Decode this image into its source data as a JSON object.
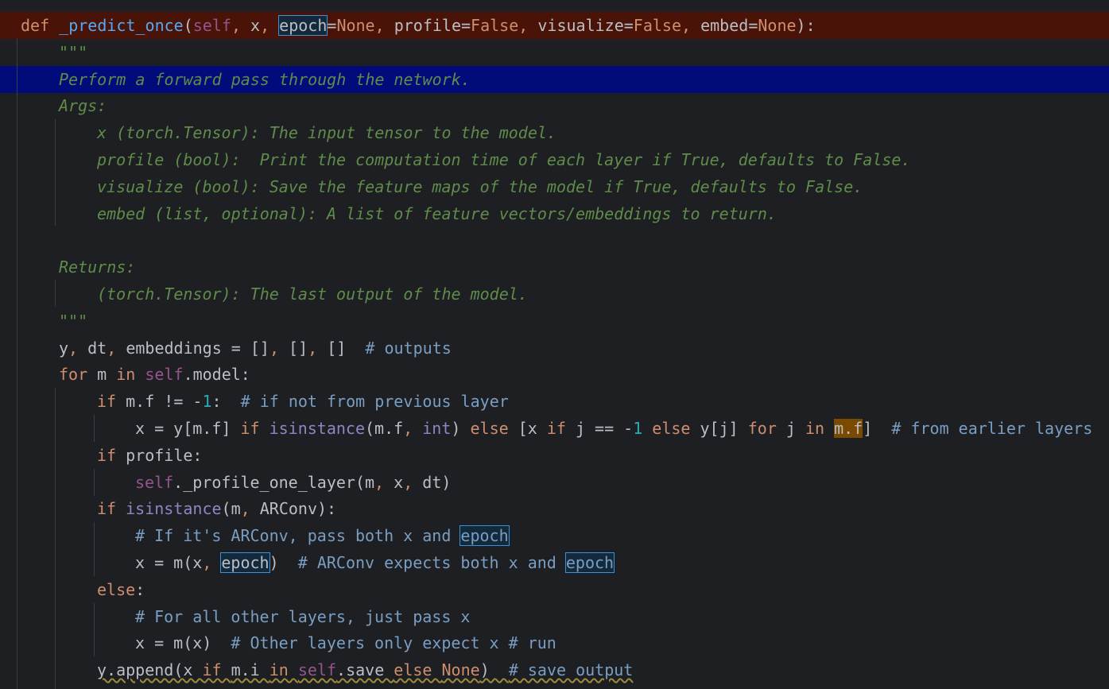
{
  "editor": {
    "lines": [
      {
        "indent": 0,
        "parts": [
          {
            "t": "def ",
            "c": "kw"
          },
          {
            "t": "_predict_once",
            "c": "fn"
          },
          {
            "t": "(",
            "c": "op"
          },
          {
            "t": "self",
            "c": "self"
          },
          {
            "t": ", ",
            "c": "kw"
          },
          {
            "t": "x",
            "c": "op"
          },
          {
            "t": ", ",
            "c": "kw"
          },
          {
            "t": "epoch",
            "c": "op",
            "box": true
          },
          {
            "t": "=",
            "c": "op"
          },
          {
            "t": "None",
            "c": "kw"
          },
          {
            "t": ", ",
            "c": "kw"
          },
          {
            "t": "profile",
            "c": "op"
          },
          {
            "t": "=",
            "c": "op"
          },
          {
            "t": "False",
            "c": "kw"
          },
          {
            "t": ", ",
            "c": "kw"
          },
          {
            "t": "visualize",
            "c": "op"
          },
          {
            "t": "=",
            "c": "op"
          },
          {
            "t": "False",
            "c": "kw"
          },
          {
            "t": ", ",
            "c": "kw"
          },
          {
            "t": "embed",
            "c": "op"
          },
          {
            "t": "=",
            "c": "op"
          },
          {
            "t": "None",
            "c": "kw"
          },
          {
            "t": "):",
            "c": "op"
          }
        ],
        "highlight": "red"
      },
      {
        "indent": 1,
        "parts": [
          {
            "t": "\"\"\"",
            "c": "doc"
          }
        ]
      },
      {
        "indent": 1,
        "parts": [
          {
            "t": "Perform a forward pass through the network.",
            "c": "doc"
          }
        ],
        "highlight": "blue"
      },
      {
        "indent": 1,
        "parts": [
          {
            "t": "Args:",
            "c": "doc"
          }
        ]
      },
      {
        "indent": 2,
        "parts": [
          {
            "t": "x (torch.Tensor): The input tensor to the model.",
            "c": "doc"
          }
        ]
      },
      {
        "indent": 2,
        "parts": [
          {
            "t": "profile (bool):  Print the computation time of each layer if True, defaults to False.",
            "c": "doc"
          }
        ]
      },
      {
        "indent": 2,
        "parts": [
          {
            "t": "visualize (bool): Save the feature maps of the model if True, defaults to False.",
            "c": "doc"
          }
        ]
      },
      {
        "indent": 2,
        "parts": [
          {
            "t": "embed (list, optional): A list of feature vectors/embeddings to return.",
            "c": "doc"
          }
        ]
      },
      {
        "indent": 0,
        "parts": []
      },
      {
        "indent": 1,
        "parts": [
          {
            "t": "Returns:",
            "c": "doc"
          }
        ]
      },
      {
        "indent": 2,
        "parts": [
          {
            "t": "(torch.Tensor): The last output of the model.",
            "c": "doc"
          }
        ]
      },
      {
        "indent": 1,
        "parts": [
          {
            "t": "\"\"\"",
            "c": "doc"
          }
        ]
      },
      {
        "indent": 1,
        "parts": [
          {
            "t": "y",
            "c": "op"
          },
          {
            "t": ", ",
            "c": "kw"
          },
          {
            "t": "dt",
            "c": "op"
          },
          {
            "t": ", ",
            "c": "kw"
          },
          {
            "t": "embeddings = []",
            "c": "op"
          },
          {
            "t": ", ",
            "c": "kw"
          },
          {
            "t": "[]",
            "c": "op"
          },
          {
            "t": ", ",
            "c": "kw"
          },
          {
            "t": "[]  ",
            "c": "op"
          },
          {
            "t": "# outputs",
            "c": "cm"
          }
        ]
      },
      {
        "indent": 1,
        "parts": [
          {
            "t": "for ",
            "c": "kw"
          },
          {
            "t": "m ",
            "c": "op"
          },
          {
            "t": "in ",
            "c": "kw"
          },
          {
            "t": "self",
            "c": "self"
          },
          {
            "t": ".model:",
            "c": "op"
          }
        ]
      },
      {
        "indent": 2,
        "parts": [
          {
            "t": "if ",
            "c": "kw"
          },
          {
            "t": "m.f != -",
            "c": "op"
          },
          {
            "t": "1",
            "c": "num"
          },
          {
            "t": ":  ",
            "c": "op"
          },
          {
            "t": "# if not from previous layer",
            "c": "cm"
          }
        ]
      },
      {
        "indent": 3,
        "parts": [
          {
            "t": "x = y[m.f] ",
            "c": "op"
          },
          {
            "t": "if ",
            "c": "kw"
          },
          {
            "t": "isinstance",
            "c": "bi"
          },
          {
            "t": "(m.f",
            "c": "op"
          },
          {
            "t": ", ",
            "c": "kw"
          },
          {
            "t": "int",
            "c": "bi"
          },
          {
            "t": ") ",
            "c": "op"
          },
          {
            "t": "else ",
            "c": "kw"
          },
          {
            "t": "[x ",
            "c": "op"
          },
          {
            "t": "if ",
            "c": "kw"
          },
          {
            "t": "j == -",
            "c": "op"
          },
          {
            "t": "1 ",
            "c": "num"
          },
          {
            "t": "else ",
            "c": "kw"
          },
          {
            "t": "y[j] ",
            "c": "op"
          },
          {
            "t": "for ",
            "c": "kw"
          },
          {
            "t": "j ",
            "c": "op"
          },
          {
            "t": "in ",
            "c": "kw"
          },
          {
            "t": "m.f",
            "c": "op",
            "orange": true
          },
          {
            "t": "]  ",
            "c": "op"
          },
          {
            "t": "# from earlier layers",
            "c": "cm"
          }
        ]
      },
      {
        "indent": 2,
        "parts": [
          {
            "t": "if ",
            "c": "kw"
          },
          {
            "t": "profile:",
            "c": "op"
          }
        ]
      },
      {
        "indent": 3,
        "parts": [
          {
            "t": "self",
            "c": "self"
          },
          {
            "t": "._profile_one_layer(m",
            "c": "op"
          },
          {
            "t": ", ",
            "c": "kw"
          },
          {
            "t": "x",
            "c": "op"
          },
          {
            "t": ", ",
            "c": "kw"
          },
          {
            "t": "dt)",
            "c": "op"
          }
        ]
      },
      {
        "indent": 2,
        "parts": [
          {
            "t": "if ",
            "c": "kw"
          },
          {
            "t": "isinstance",
            "c": "bi"
          },
          {
            "t": "(m",
            "c": "op"
          },
          {
            "t": ", ",
            "c": "kw"
          },
          {
            "t": "ARConv):",
            "c": "op"
          }
        ]
      },
      {
        "indent": 3,
        "parts": [
          {
            "t": "# If it's ARConv, pass both x and ",
            "c": "cm"
          },
          {
            "t": "epoch",
            "c": "cm",
            "box": true
          }
        ]
      },
      {
        "indent": 3,
        "parts": [
          {
            "t": "x = m(x",
            "c": "op"
          },
          {
            "t": ", ",
            "c": "kw"
          },
          {
            "t": "epoch",
            "c": "op",
            "box": true
          },
          {
            "t": ")  ",
            "c": "op"
          },
          {
            "t": "# ARConv expects both x and ",
            "c": "cm"
          },
          {
            "t": "epoch",
            "c": "cm",
            "box": true
          }
        ]
      },
      {
        "indent": 2,
        "parts": [
          {
            "t": "else",
            "c": "kw"
          },
          {
            "t": ":",
            "c": "op"
          }
        ]
      },
      {
        "indent": 3,
        "parts": [
          {
            "t": "# For all other layers, just pass x",
            "c": "cm"
          }
        ]
      },
      {
        "indent": 3,
        "parts": [
          {
            "t": "x = m(x)  ",
            "c": "op"
          },
          {
            "t": "# Other layers only expect x # run",
            "c": "cm"
          }
        ]
      },
      {
        "indent": 2,
        "parts": [
          {
            "t": "y.append(x ",
            "c": "op",
            "squiggle": true
          },
          {
            "t": "if ",
            "c": "kw",
            "squiggle": true
          },
          {
            "t": "m.i ",
            "c": "op",
            "squiggle": true
          },
          {
            "t": "in ",
            "c": "kw",
            "squiggle": true
          },
          {
            "t": "self",
            "c": "self",
            "squiggle": true
          },
          {
            "t": ".save ",
            "c": "op",
            "squiggle": true
          },
          {
            "t": "else ",
            "c": "kw",
            "squiggle": true
          },
          {
            "t": "None",
            "c": "kw",
            "squiggle": true
          },
          {
            "t": ")  ",
            "c": "op",
            "squiggle": true
          },
          {
            "t": "# save output",
            "c": "cm",
            "squiggle": true
          }
        ]
      }
    ]
  },
  "colors": {
    "background": "#1e1f22",
    "keyword": "#cf8e6d",
    "function": "#56a8f5",
    "self": "#94558d",
    "docstring": "#5f8c4a",
    "comment": "#7a9ec2",
    "number": "#2aacb8",
    "error-line": "#4a1308",
    "selected-line": "#020b7a"
  }
}
